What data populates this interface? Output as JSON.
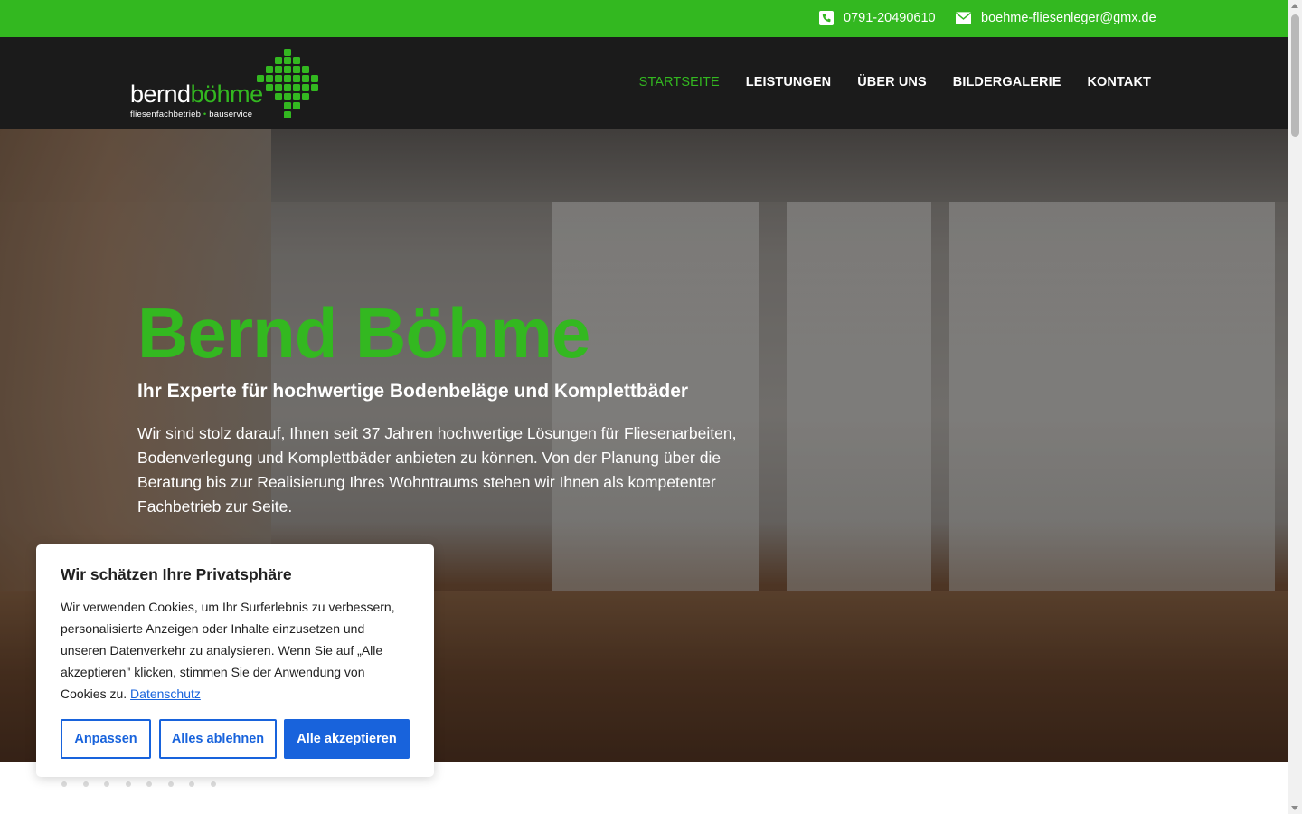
{
  "topbar": {
    "phone": "0791-20490610",
    "email": "boehme-fliesenleger@gmx.de",
    "phone_icon": "phone-icon",
    "email_icon": "envelope-icon"
  },
  "logo": {
    "word_part1": "bernd",
    "word_part2": "böhme",
    "sub_part1": "fliesenfachbetrieb",
    "sub_dot": "•",
    "sub_part2": "bauservice"
  },
  "nav": {
    "items": [
      {
        "label": "STARTSEITE",
        "active": true
      },
      {
        "label": "LEISTUNGEN",
        "active": false
      },
      {
        "label": "ÜBER UNS",
        "active": false
      },
      {
        "label": "BILDERGALERIE",
        "active": false
      },
      {
        "label": "KONTAKT",
        "active": false
      }
    ]
  },
  "hero": {
    "title": "Bernd Böhme",
    "subtitle": "Ihr Experte für hochwertige Bodenbeläge und Komplettbäder",
    "text": "Wir sind stolz darauf, Ihnen seit 37 Jahren hochwertige Lösungen für Fliesenarbeiten, Bodenverlegung und Komplettbäder anbieten zu können. Von der Planung über die Beratung bis zur Realisierung Ihres Wohntraums stehen wir Ihnen als kompetenter Fachbetrieb zur Seite."
  },
  "cookie": {
    "title": "Wir schätzen Ihre Privatsphäre",
    "text": "Wir verwenden Cookies, um Ihr Surferlebnis zu verbessern, personalisierte Anzeigen oder Inhalte einzusetzen und unseren Datenverkehr zu analysieren. Wenn Sie auf „Alle akzeptieren\" klicken, stimmen Sie der Anwendung von Cookies zu.",
    "link": "Datenschutz",
    "btn_customize": "Anpassen",
    "btn_reject": "Alles ablehnen",
    "btn_accept": "Alle akzeptieren"
  },
  "colors": {
    "brand_green": "#33b820",
    "header_dark": "#1b1b1b",
    "button_blue": "#1863dc"
  }
}
